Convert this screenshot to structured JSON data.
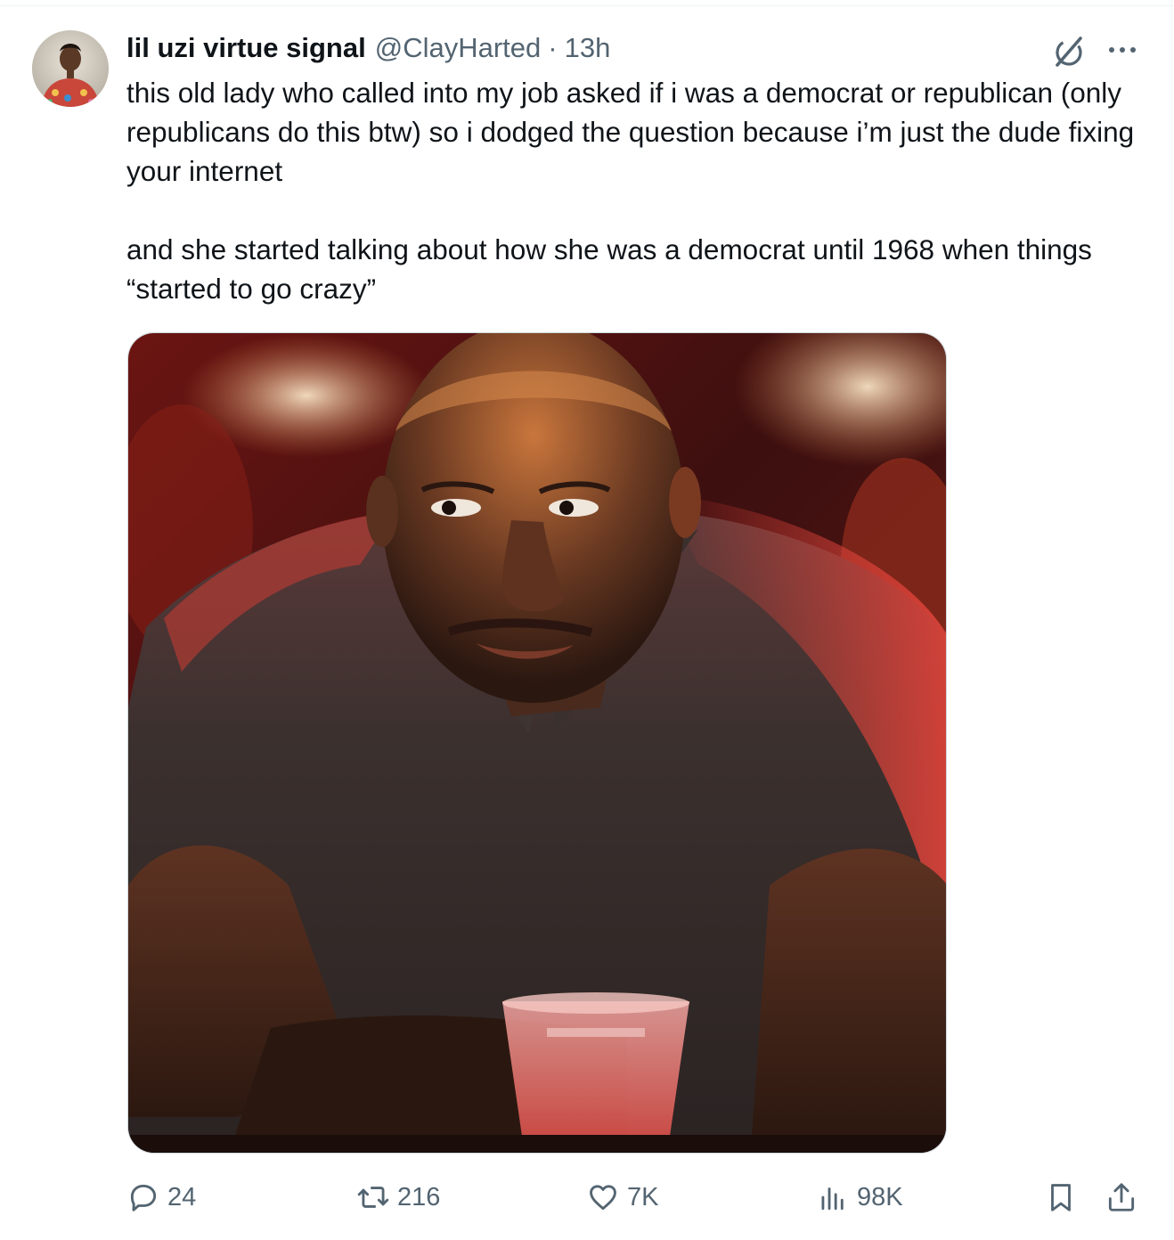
{
  "tweet": {
    "author": {
      "display_name": "lil uzi virtue signal",
      "handle": "@ClayHarted",
      "separator": "·",
      "time": "13h",
      "avatar_icon": "profile-photo"
    },
    "paragraphs": [
      "this old lady who called into my job asked if i was a democrat or republican (only republicans do this btw) so i dodged the question because i’m just the dude fixing your internet",
      "and she started talking about how she was a democrat until 1968 when things “started to go crazy”"
    ],
    "media": {
      "kind": "photo",
      "icon": "photo-man-at-bar-with-red-cup"
    },
    "actions": {
      "replies": "24",
      "reposts": "216",
      "likes": "7K",
      "views": "98K"
    },
    "icons": {
      "grok": "grok-icon",
      "more": "more-icon",
      "reply": "reply-icon",
      "repost": "repost-icon",
      "like": "heart-icon",
      "views": "views-icon",
      "bookmark": "bookmark-icon",
      "share": "share-icon"
    }
  },
  "colors": {
    "text_primary": "#0f1419",
    "text_secondary": "#536471",
    "border": "#cfd9de",
    "background": "#ffffff"
  }
}
